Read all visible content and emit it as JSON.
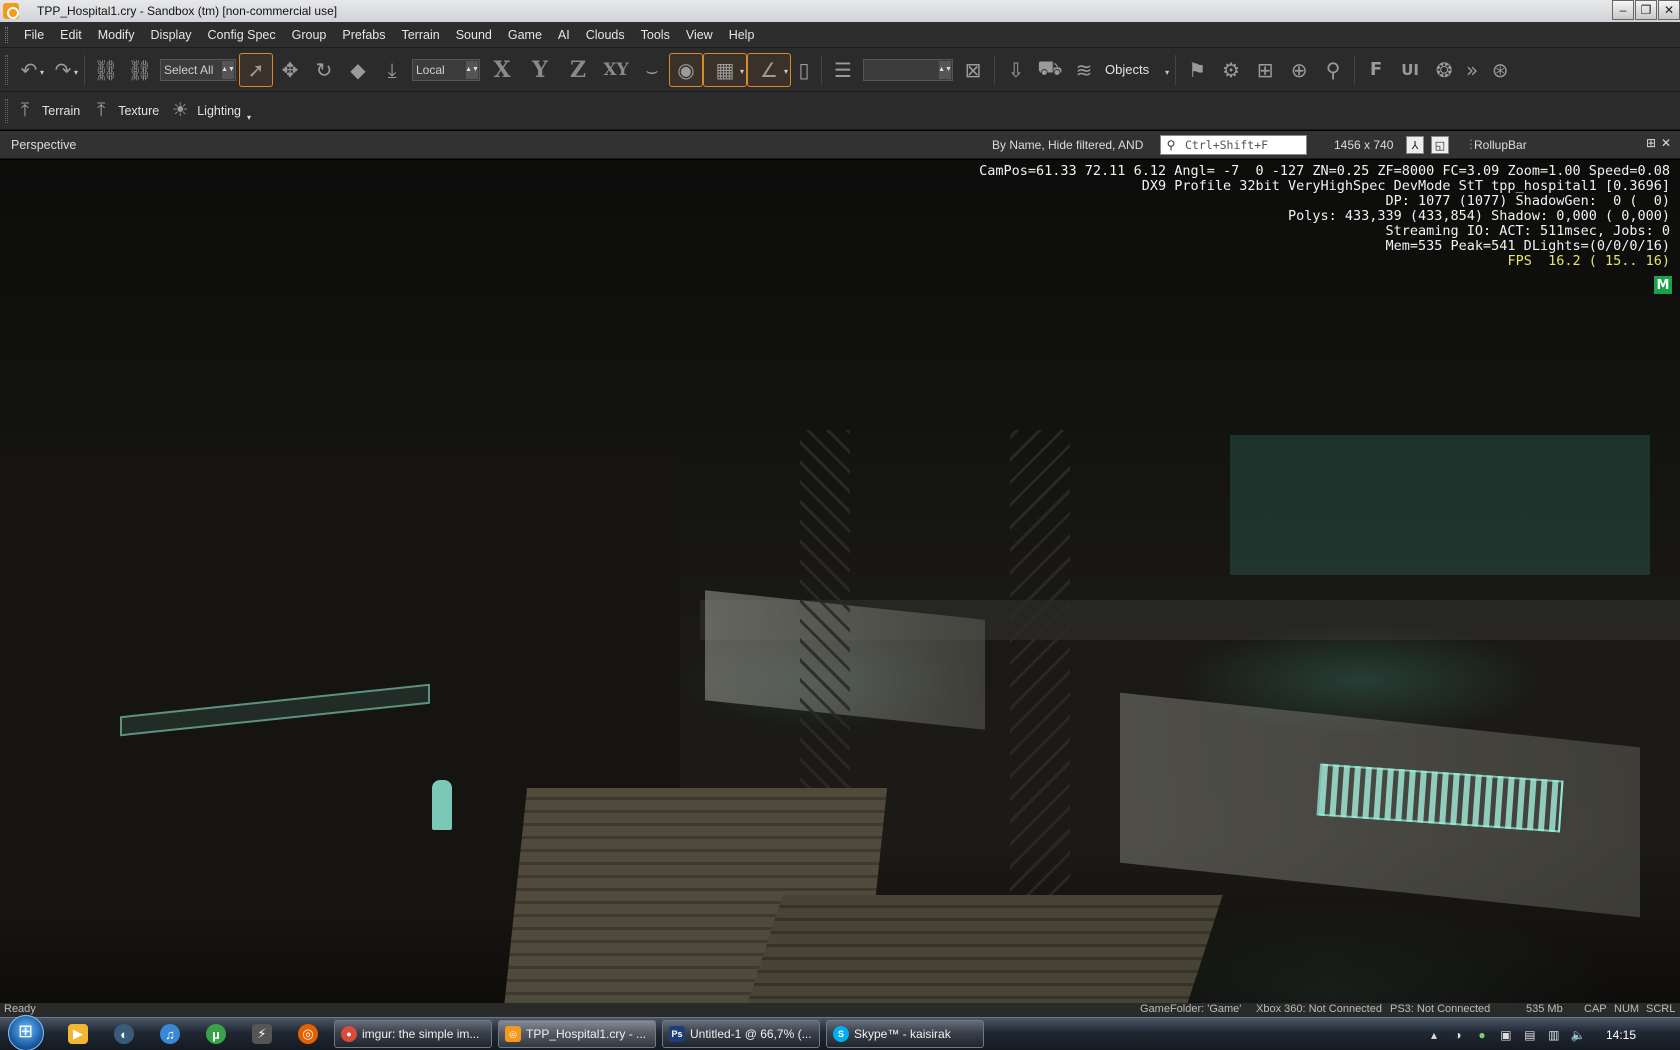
{
  "window": {
    "title": "TPP_Hospital1.cry - Sandbox (tm) [non-commercial use]",
    "controls": [
      "–",
      "❐",
      "✕"
    ]
  },
  "menu": [
    "File",
    "Edit",
    "Modify",
    "Display",
    "Config Spec",
    "Group",
    "Prefabs",
    "Terrain",
    "Sound",
    "Game",
    "AI",
    "Clouds",
    "Tools",
    "View",
    "Help"
  ],
  "toolbar": {
    "select_all": "Select All",
    "coord_system": "Local",
    "axes": [
      "X",
      "Y",
      "Z",
      "XY"
    ],
    "layer_value": "",
    "objects_label": "Objects"
  },
  "toolbar2": [
    {
      "label": "Terrain",
      "icon": "terrain-tool-icon"
    },
    {
      "label": "Texture",
      "icon": "texture-tool-icon"
    },
    {
      "label": "Lighting",
      "icon": "lighting-sun-icon"
    }
  ],
  "viewport_header": {
    "title": "Perspective",
    "filter_text": "By Name, Hide filtered, AND",
    "search_placeholder": "Ctrl+Shift+F",
    "resolution": "1456 x 740",
    "rollup_title": "RollupBar",
    "pin": "⊞",
    "close": "✕"
  },
  "hud": {
    "line1": "CamPos=61.33 72.11 6.12 Angl= -7  0 -127 ZN=0.25 ZF=8000 FC=3.09 Zoom=1.00 Speed=0.08",
    "line2": "DX9 Profile 32bit VeryHighSpec DevMode StT tpp_hospital1 [0.3696]",
    "line3": "DP: 1077 (1077) ShadowGen:  0 (  0)",
    "line4": "Polys: 433,339 (433,854) Shadow: 0,000 ( 0,000)",
    "line5": "Streaming IO: ACT: 511msec, Jobs: 0",
    "line6": "Mem=535 Peak=541 DLights=(0/0/0/16)",
    "fps": "FPS  16.2 ( 15.. 16)",
    "badge": "M"
  },
  "status": {
    "left": "Ready",
    "game_folder": "GameFolder: 'Game'",
    "xbox": "Xbox 360: Not Connected",
    "ps3": "PS3: Not Connected",
    "mem": "535 Mb",
    "cap": "CAP",
    "num": "NUM",
    "scrl": "SCRL"
  },
  "taskbar": {
    "tasks": [
      {
        "label": "imgur: the simple im...",
        "icon": "chrome-icon",
        "color": "#d94a38",
        "active": false
      },
      {
        "label": "TPP_Hospital1.cry - ...",
        "icon": "sandbox-icon",
        "color": "#f39a1c",
        "active": true
      },
      {
        "label": "Untitled-1 @ 66,7% (...",
        "icon": "photoshop-icon",
        "color": "#1c3f78",
        "active": false
      },
      {
        "label": "Skype™ - kaisirak",
        "icon": "skype-icon",
        "color": "#00aff0",
        "active": false
      }
    ],
    "pins": [
      {
        "icon": "media-player-icon",
        "color": "#f1b632"
      },
      {
        "icon": "steam-icon",
        "color": "#3b5b7a"
      },
      {
        "icon": "itunes-icon",
        "color": "#3a87d6"
      },
      {
        "icon": "utorrent-icon",
        "color": "#3aa14a"
      },
      {
        "icon": "winamp-icon",
        "color": "#555555"
      },
      {
        "icon": "firefox-icon",
        "color": "#e66000"
      }
    ],
    "clock": "14:15"
  }
}
